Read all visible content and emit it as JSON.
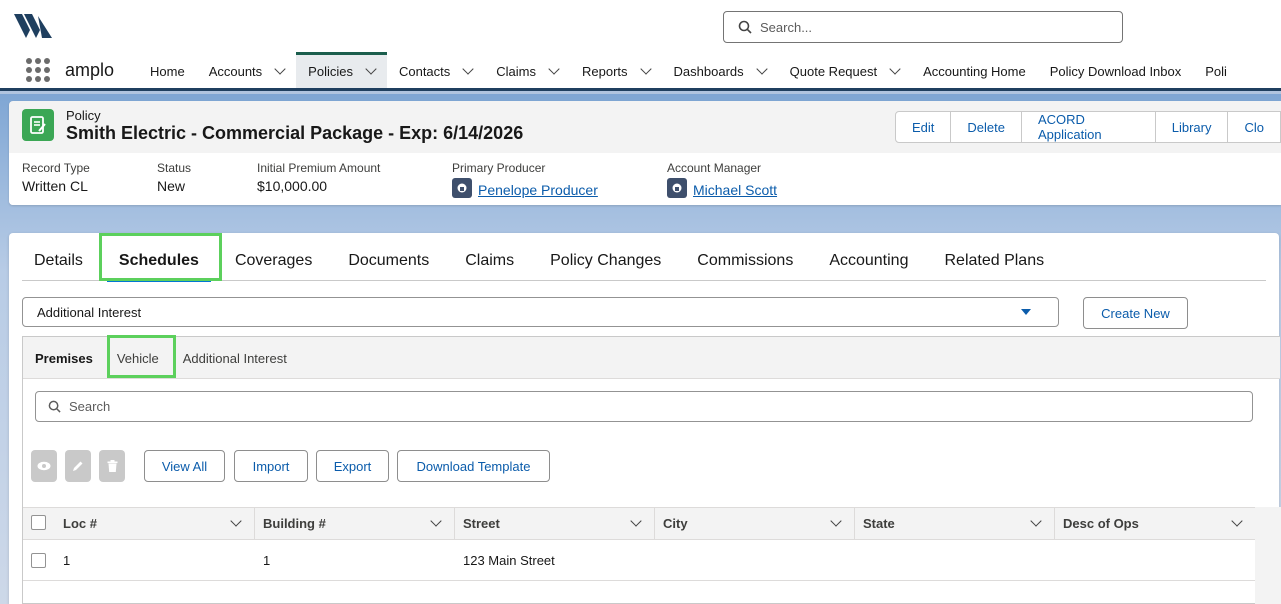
{
  "header": {
    "search_placeholder": "Search...",
    "app_name": "amplo"
  },
  "nav": {
    "items": [
      {
        "label": "Home",
        "has_menu": false,
        "active": false
      },
      {
        "label": "Accounts",
        "has_menu": true,
        "active": false
      },
      {
        "label": "Policies",
        "has_menu": true,
        "active": true
      },
      {
        "label": "Contacts",
        "has_menu": true,
        "active": false
      },
      {
        "label": "Claims",
        "has_menu": true,
        "active": false
      },
      {
        "label": "Reports",
        "has_menu": true,
        "active": false
      },
      {
        "label": "Dashboards",
        "has_menu": true,
        "active": false
      },
      {
        "label": "Quote Request",
        "has_menu": true,
        "active": false
      },
      {
        "label": "Accounting Home",
        "has_menu": false,
        "active": false
      },
      {
        "label": "Policy Download Inbox",
        "has_menu": false,
        "active": false
      },
      {
        "label": "Poli",
        "has_menu": false,
        "active": false
      }
    ]
  },
  "record": {
    "object_label": "Policy",
    "title": "Smith Electric - Commercial Package - Exp: 6/14/2026",
    "actions": [
      "Edit",
      "Delete",
      "ACORD Application",
      "Library",
      "Clo"
    ],
    "fields": {
      "record_type": {
        "label": "Record Type",
        "value": "Written CL"
      },
      "status": {
        "label": "Status",
        "value": "New"
      },
      "premium": {
        "label": "Initial Premium Amount",
        "value": "$10,000.00"
      },
      "producer": {
        "label": "Primary Producer",
        "value": "Penelope Producer"
      },
      "manager": {
        "label": "Account Manager",
        "value": "Michael Scott"
      }
    }
  },
  "tabs": [
    "Details",
    "Schedules",
    "Coverages",
    "Documents",
    "Claims",
    "Policy Changes",
    "Commissions",
    "Accounting",
    "Related Plans"
  ],
  "active_tab": "Schedules",
  "schedule": {
    "type_selected": "Additional Interest",
    "create_new_label": "Create New",
    "sub_tabs": [
      "Premises",
      "Vehicle",
      "Additional Interest"
    ],
    "active_sub_tab": "Premises",
    "search_placeholder": "Search",
    "toolbar": {
      "view_all": "View All",
      "import": "Import",
      "export": "Export",
      "download_template": "Download Template"
    },
    "columns": [
      "Loc #",
      "Building #",
      "Street",
      "City",
      "State",
      "Desc of Ops"
    ],
    "rows": [
      {
        "loc": "1",
        "building": "1",
        "street": "123 Main Street",
        "city": "",
        "state": "",
        "desc": ""
      }
    ]
  },
  "colors": {
    "brand_link": "#0b5cab",
    "highlight_box": "#5cd05c",
    "record_icon": "#3ba755",
    "nav_active_border": "#1b5e4d"
  }
}
